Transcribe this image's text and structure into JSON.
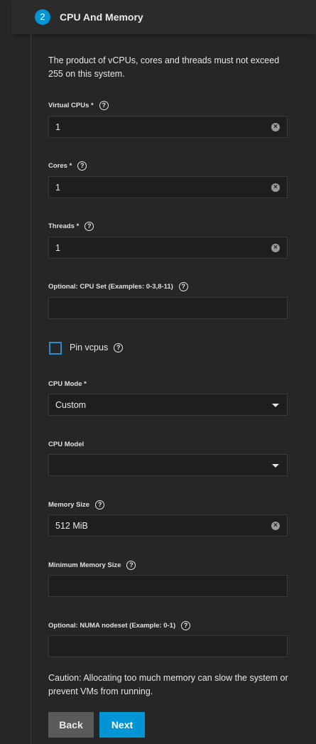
{
  "step": {
    "number": "2",
    "title": "CPU And Memory"
  },
  "info_note": "The product of vCPUs, cores and threads must not exceed 255 on this system.",
  "fields": {
    "vcpus": {
      "label": "Virtual CPUs *",
      "value": "1"
    },
    "cores": {
      "label": "Cores *",
      "value": "1"
    },
    "threads": {
      "label": "Threads *",
      "value": "1"
    },
    "cpu_set": {
      "label": "Optional: CPU Set (Examples: 0-3,8-11)",
      "value": ""
    },
    "pin_vcpus": {
      "label": "Pin vcpus",
      "checked": false
    },
    "cpu_mode": {
      "label": "CPU Mode *",
      "value": "Custom"
    },
    "cpu_model": {
      "label": "CPU Model",
      "value": ""
    },
    "memory_size": {
      "label": "Memory Size",
      "value": "512 MiB"
    },
    "min_memory_size": {
      "label": "Minimum Memory Size",
      "value": ""
    },
    "numa_nodeset": {
      "label": "Optional: NUMA nodeset (Example: 0-1)",
      "value": ""
    }
  },
  "caution_note": "Caution: Allocating too much memory can slow the system or prevent VMs from running.",
  "buttons": {
    "back": "Back",
    "next": "Next"
  },
  "icons": {
    "help": "?",
    "clear": "×"
  },
  "colors": {
    "accent": "#0095d5",
    "background": "#262626",
    "field_bg": "#1e1e1e"
  }
}
